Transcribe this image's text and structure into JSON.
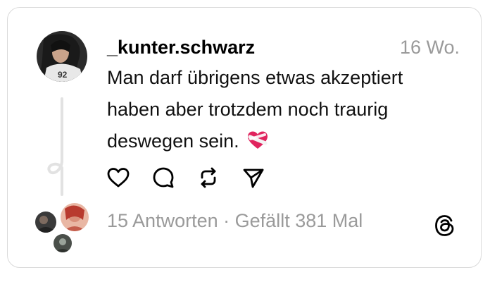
{
  "post": {
    "username": "_kunter.schwarz",
    "timestamp": "16 Wo.",
    "text": "Man darf übrigens etwas akzeptiert haben aber trotzdem noch traurig deswegen sein.",
    "emoji": "mending-heart-emoji",
    "jersey_number": "92"
  },
  "actions": {
    "like": "heart-icon",
    "reply": "comment-bubble-icon",
    "repost": "repost-icon",
    "share": "send-icon"
  },
  "meta": {
    "replies_count": "15 Antworten",
    "separator": "·",
    "likes_text": "Gefällt 381 Mal"
  },
  "brand": {
    "logo": "threads-logo-icon"
  },
  "colors": {
    "text": "#111111",
    "muted": "#9a9a9a",
    "border": "#dadada",
    "heart_red": "#e0245e"
  }
}
